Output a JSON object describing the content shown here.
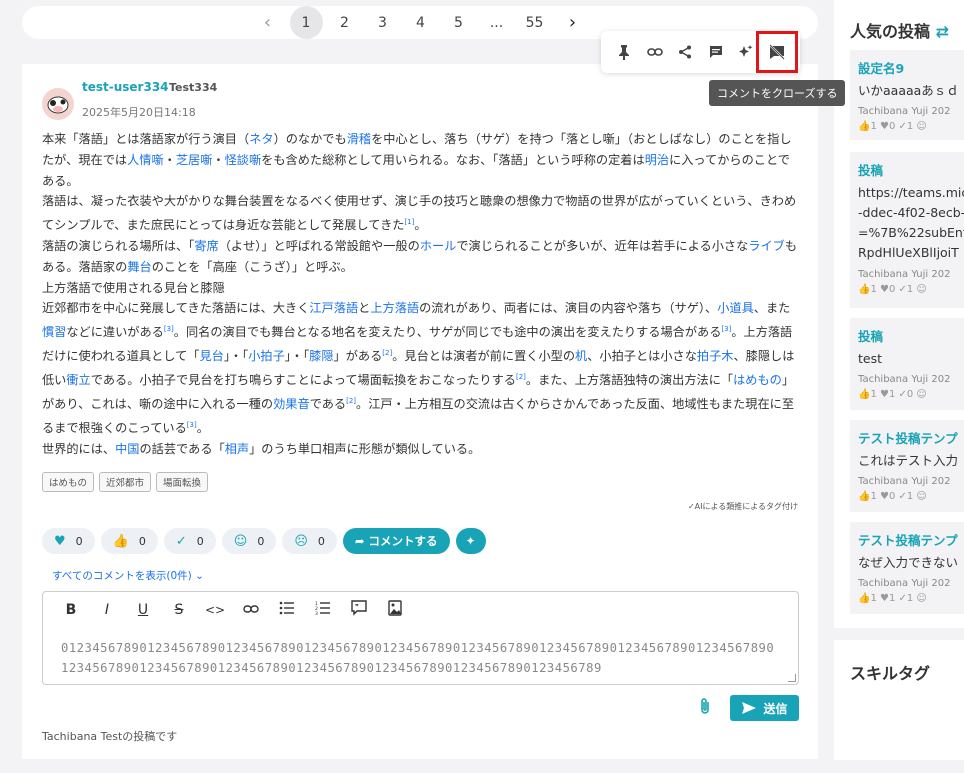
{
  "pagination": {
    "prev": "‹",
    "pages": [
      "1",
      "2",
      "3",
      "4",
      "5",
      "...",
      "55"
    ],
    "active": "1",
    "next": "›"
  },
  "toolbar": {
    "icons": [
      "pin-icon",
      "link-icon",
      "share-icon",
      "comment-icon",
      "ai-sparkle-icon",
      "close-comments-icon"
    ],
    "tooltip": "コメントをクローズする"
  },
  "post": {
    "username": "test-user334",
    "handle": "Test334",
    "date": "2025年5月20日14:18",
    "paragraphs": [
      "本来「落語」とは落語家が行う演目（ネタ）のなかでも滑稽を中心とし、落ち（サゲ）を持つ「落とし噺」（おとしばなし）のことを指したが、現在では人情噺・芝居噺・怪談噺をも含めた総称として用いられる。なお、「落語」という呼称の定着は明治に入ってからのことである。",
      "落語は、凝った衣装や大がかりな舞台装置をなるべく使用せず、演じ手の技巧と聴衆の想像力で物語の世界が広がっていくという、きわめてシンプルで、また庶民にとっては身近な芸能として発展してきた",
      "落語の演じられる場所は、「寄席（よせ）」と呼ばれる常設館や一般のホールで演じられることが多いが、近年は若手による小さなライブもある。落語家の舞台のことを「高座（こうざ）」と呼ぶ。",
      "上方落語で使用される見台と膝隠",
      "近郊都市を中心に発展してきた落語には、大きく江戸落語と上方落語の流れがあり、両者には、演目の内容や落ち（サゲ）、小道具、また慣習などに違いがある",
      "世界的には、中国の話芸である「相声」のうち単口相声に形態が類似している。"
    ],
    "tags": [
      "はめもの",
      "近郊都市",
      "場面転換"
    ],
    "ai_tag_note": "✓AIによる類推によるタグ付け"
  },
  "reactions": [
    {
      "icon": "heart-icon",
      "glyph": "♥",
      "count": "0"
    },
    {
      "icon": "thumbs-up-icon",
      "glyph": "👍",
      "count": "0"
    },
    {
      "icon": "check-icon",
      "glyph": "✓",
      "count": "0"
    },
    {
      "icon": "smile-icon",
      "glyph": "☺",
      "count": "0"
    },
    {
      "icon": "surprised-icon",
      "glyph": "☹",
      "count": "0"
    }
  ],
  "comment_button": "コメントする",
  "show_all": "すべてのコメントを表示(0件)",
  "editor": {
    "tools": [
      "B",
      "I",
      "U",
      "S",
      "<>",
      "🔗",
      "☰",
      "≡",
      "❝",
      "▣"
    ],
    "text": "0123456789012345678901234567890123456789012345678901234567890123456789012345678901234567890123456789012345678901234567890123456789012345678901234567890123456789"
  },
  "send_button": "送信",
  "footer_note": "Tachibana Testの投稿です",
  "sidebar": {
    "title": "人気の投稿",
    "posts": [
      {
        "title": "設定名9",
        "body": [
          "いかaaaaaあｓｄ"
        ],
        "author": "Tachibana Yuji",
        "year": "202",
        "stats": "👍1 ♥0 ✓1 ☺"
      },
      {
        "title": "投稿",
        "body": [
          "https://teams.mic",
          "-ddec-4f02-8ecb-",
          "=%7B%22subEnti",
          "RpdHlUeXBlIjoiT"
        ],
        "author": "Tachibana Yuji",
        "year": "202",
        "stats": "👍1 ♥0 ✓1 ☺"
      },
      {
        "title": "投稿",
        "body": [
          "test"
        ],
        "author": "Tachibana Yuji",
        "year": "202",
        "stats": "👍1 ♥1 ✓0 ☺"
      },
      {
        "title": "テスト投稿テンプ",
        "body": [
          "これはテスト入力"
        ],
        "author": "Tachibana Yuji",
        "year": "202",
        "stats": "👍1 ♥0 ✓1 ☺"
      },
      {
        "title": "テスト投稿テンプ",
        "body": [
          "なぜ入力できない"
        ],
        "author": "Tachibana Yuji",
        "year": "202",
        "stats": "👍1 ♥1 ✓1 ☺"
      }
    ],
    "skill_title": "スキルタグ"
  }
}
